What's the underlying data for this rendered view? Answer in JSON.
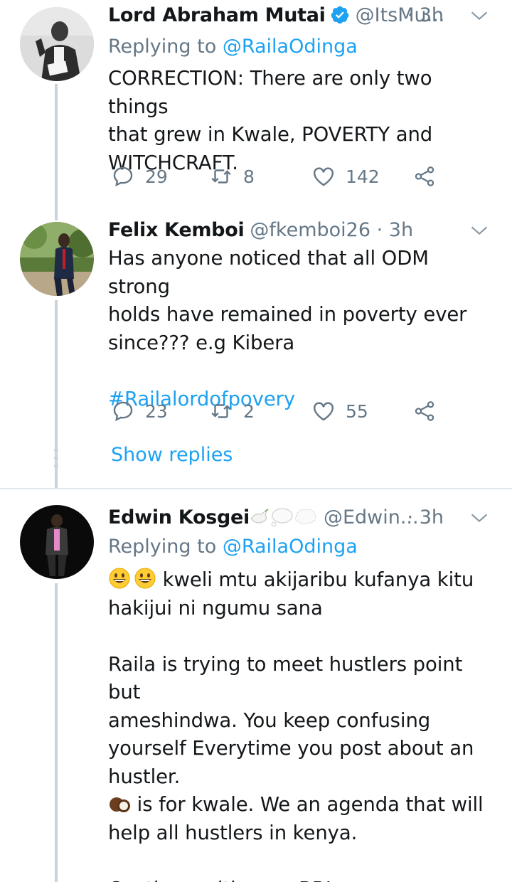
{
  "tweets": [
    {
      "name": "Lord Abraham Mutai",
      "handle": "@ItsMu...",
      "time": "· 3h",
      "replying_prefix": "Replying to ",
      "replying_to": "@RailaOdinga",
      "lines": [
        "CORRECTION: There are only two things",
        "that grew in Kwale, POVERTY and",
        "WITCHCRAFT."
      ],
      "replies": "29",
      "retweets": "8",
      "likes": "142"
    },
    {
      "name": "Felix Kemboi",
      "handle": "@fkemboi26",
      "time": "· 3h",
      "lines": [
        "Has anyone noticed that all ODM strong",
        "holds have remained in poverty ever",
        "since??? e.g Kibera"
      ],
      "hashtag": "#Railalordofpovery",
      "replies": "23",
      "retweets": "2",
      "likes": "55",
      "show_replies": "Show replies"
    },
    {
      "name": "Edwin Kosgei",
      "handle": "@Edwin...",
      "time": "· 3h",
      "replying_prefix": "Replying to ",
      "replying_to": "@RailaOdinga",
      "line1": "kweli mtu akijaribu kufanya kitu",
      "line2": "hakijui ni ngumu sana",
      "para2": [
        "Raila is trying to meet hustlers point but",
        "ameshindwa. You keep confusing",
        "yourself Everytime you post about an",
        "hustler."
      ],
      "line_coconut": "is for kwale. We an agenda that will",
      "line_after": "help all hustlers in kenya.",
      "closing": "Continue with your BBI"
    }
  ],
  "colors": {
    "link": "#1da1f2",
    "muted": "#657786",
    "text": "#14171a",
    "line": "#c9d3db",
    "divider": "#e1e8ed"
  },
  "icons": [
    "verified-badge-icon",
    "chevron-down-icon",
    "reply-icon",
    "retweet-icon",
    "like-icon",
    "share-icon",
    "dove-emoji",
    "thought-bubble-emoji",
    "grinning-emoji",
    "coconut-emoji"
  ]
}
